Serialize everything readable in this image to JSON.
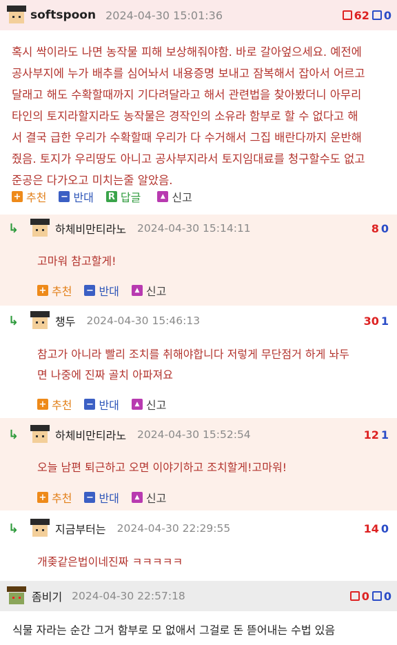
{
  "post": {
    "username": "softspoon",
    "date": "2024-04-30 15:01:36",
    "up": "62",
    "down": "0",
    "body": [
      "혹시 싹이라도 나면 농작물 피해 보상해줘야함. 바로 갈아엎으세요. 예전에",
      "공사부지에 누가 배추를 심어놔서 내용증명 보내고 잠복해서 잡아서 어르고",
      "달래고 해도 수확할때까지 기다려달라고 해서 관련법을 찾아봤더니 아무리",
      "타인의 토지라할지라도 농작물은 경작인의 소유라 함부로 할 수 없다고 해",
      "서 결국 급한 우리가 수확할때 우리가 다 수거해서 그집 배란다까지 운반해",
      "줬음. 토지가 우리땅도 아니고 공사부지라서 토지임대료를 청구할수도 없고",
      "준공은 다가오고 미치는줄 알았음."
    ],
    "actions": {
      "recommend": "추천",
      "oppose": "반대",
      "reply": "답글",
      "report": "신고"
    }
  },
  "comments": [
    {
      "username": "하체비만티라노",
      "date": "2024-04-30 15:14:11",
      "up": "8",
      "down": "0",
      "body": [
        "고마워 참고할게!"
      ],
      "actions": {
        "recommend": "추천",
        "oppose": "반대",
        "report": "신고"
      }
    },
    {
      "username": "챙두",
      "date": "2024-04-30 15:46:13",
      "up": "30",
      "down": "1",
      "body": [
        "참고가 아니라 빨리 조치를 취해야합니다 저렇게 무단점거 하게 놔두",
        "면 나중에 진짜 골치 아파져요"
      ],
      "actions": {
        "recommend": "추천",
        "oppose": "반대",
        "report": "신고"
      }
    },
    {
      "username": "하체비만티라노",
      "date": "2024-04-30 15:52:54",
      "up": "12",
      "down": "1",
      "body": [
        "오늘 남편 퇴근하고 오면 이야기하고 조치할게!고마워!"
      ],
      "actions": {
        "recommend": "추천",
        "oppose": "반대",
        "report": "신고"
      }
    },
    {
      "username": "지금부터는",
      "date": "2024-04-30 22:29:55",
      "up": "14",
      "down": "0",
      "body": [
        "개좆같은법이네진짜 ㅋㅋㅋㅋㅋ"
      ]
    }
  ],
  "last_post": {
    "username": "좀비기",
    "date": "2024-04-30 22:57:18",
    "up": "0",
    "down": "0",
    "body": "식물 자라는 순간 그거 함부로 모 없애서 그걸로 돈 뜯어내는 수법 있음"
  },
  "colors": {
    "accent_red": "#b3342e",
    "up_red": "#d22",
    "down_blue": "#2a4cc7",
    "reply_green": "#2e9a3c"
  },
  "icons": [
    "reply-arrow-icon",
    "thumb-up-icon",
    "thumb-down-icon",
    "plus-icon",
    "minus-icon",
    "reply-icon",
    "report-icon",
    "avatar-icon"
  ]
}
